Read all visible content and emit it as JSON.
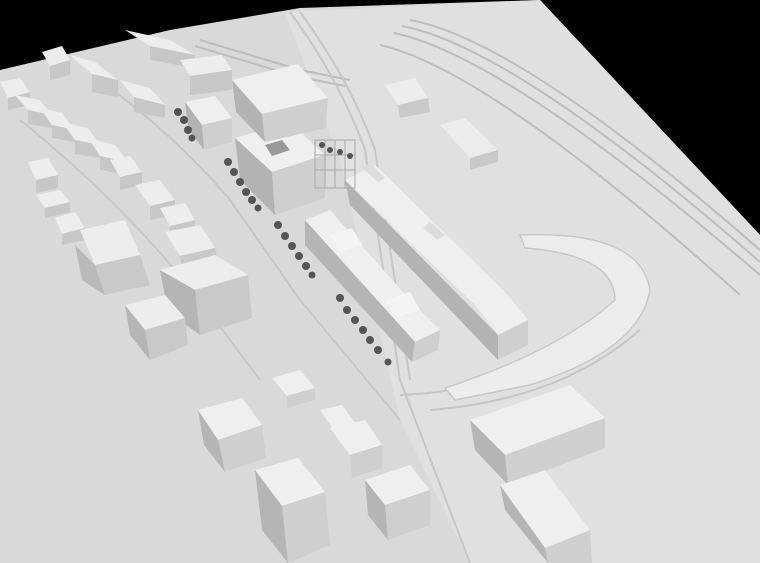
{
  "image": {
    "subject": "architectural-massing-model",
    "palette": {
      "background": "#000000",
      "base": "#d9d9d9",
      "base_light": "#e4e4e4",
      "roof": "#ededed",
      "wall_light": "#d2d2d2",
      "wall_dark": "#b5b5b5",
      "line": "#c4c4c4",
      "tree": "#555555"
    }
  }
}
